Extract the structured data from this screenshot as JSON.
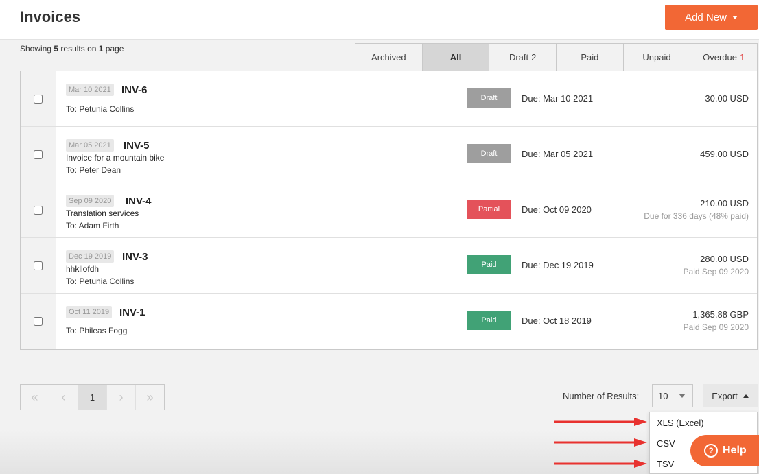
{
  "header": {
    "title": "Invoices",
    "add_new_label": "Add New"
  },
  "summary": {
    "prefix": "Showing ",
    "count": "5",
    "middle": " results on ",
    "pages": "1",
    "suffix": " page"
  },
  "tabs": [
    {
      "label": "Archived",
      "count": ""
    },
    {
      "label": "All",
      "count": ""
    },
    {
      "label": "Draft",
      "count": "2"
    },
    {
      "label": "Paid",
      "count": ""
    },
    {
      "label": "Unpaid",
      "count": ""
    },
    {
      "label": "Overdue",
      "count": "1"
    }
  ],
  "invoices": [
    {
      "date": "Mar 10 2021",
      "number": "INV-6",
      "description": "",
      "to": "To: Petunia Collins",
      "status": "Draft",
      "due": "Due: Mar 10 2021",
      "amount": "30.00 USD",
      "note": ""
    },
    {
      "date": "Mar 05 2021",
      "number": "INV-5",
      "description": "Invoice for a mountain bike",
      "to": "To: Peter Dean",
      "status": "Draft",
      "due": "Due: Mar 05 2021",
      "amount": "459.00 USD",
      "note": ""
    },
    {
      "date": "Sep 09 2020",
      "number": "INV-4",
      "description": "Translation services",
      "to": "To: Adam Firth",
      "status": "Partial",
      "due": "Due: Oct 09 2020",
      "amount": "210.00 USD",
      "note": "Due for 336 days (48% paid)"
    },
    {
      "date": "Dec 19 2019",
      "number": "INV-3",
      "description": "hhkllofdh",
      "to": "To: Petunia Collins",
      "status": "Paid",
      "due": "Due: Dec 19 2019",
      "amount": "280.00 USD",
      "note": "Paid Sep 09 2020"
    },
    {
      "date": "Oct 11 2019",
      "number": "INV-1",
      "description": "",
      "to": "To: Phileas Fogg",
      "status": "Paid",
      "due": "Due: Oct 18 2019",
      "amount": "1,365.88 GBP",
      "note": "Paid Sep 09 2020"
    }
  ],
  "pagination": {
    "first": "«",
    "prev": "‹",
    "current": "1",
    "next": "›",
    "last": "»"
  },
  "results": {
    "label": "Number of Results:",
    "value": "10"
  },
  "export": {
    "label": "Export",
    "options": [
      "XLS (Excel)",
      "CSV",
      "TSV"
    ]
  },
  "help": {
    "label": "Help",
    "icon": "?"
  },
  "colors": {
    "accent": "#f26735",
    "draft": "#9e9e9e",
    "partial": "#e4525a",
    "paid": "#41a276",
    "overdue_count": "#e14c4c",
    "arrow": "#e8322f"
  }
}
